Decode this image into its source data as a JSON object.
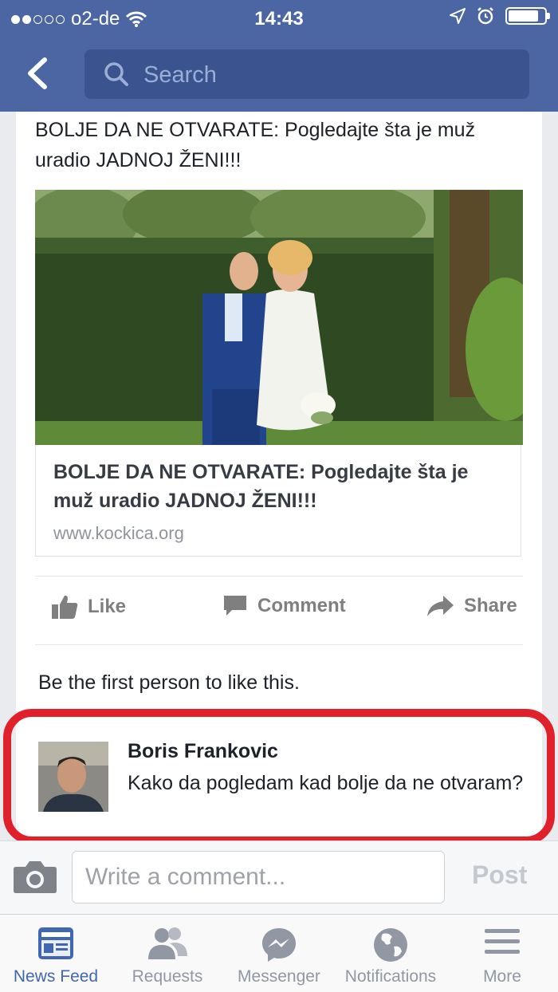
{
  "status_bar": {
    "carrier": "o2-de",
    "time": "14:43",
    "signal_dots_filled": 2,
    "signal_dots_total": 5,
    "battery_level": 0.85
  },
  "nav": {
    "back_icon": "chevron-left-icon",
    "search_placeholder": "Search"
  },
  "post": {
    "text": "BOLJE DA NE OTVARATE: Pogledajte šta je muž uradio JADNOJ ŽENI!!!",
    "link_preview": {
      "title": "BOLJE DA NE OTVARATE: Pogledajte šta je muž uradio JADNOJ ŽENI!!!",
      "domain": "www.kockica.org"
    },
    "actions": {
      "like": "Like",
      "comment": "Comment",
      "share": "Share"
    },
    "likes_summary": "Be the first person to like this."
  },
  "comment": {
    "author": "Boris Frankovic",
    "text": "Kako da pogledam kad bolje da ne otvaram?"
  },
  "compose": {
    "placeholder": "Write a comment...",
    "post_label": "Post"
  },
  "tabs": [
    {
      "label": "News Feed",
      "icon": "news-feed-icon",
      "active": true
    },
    {
      "label": "Requests",
      "icon": "friend-requests-icon",
      "active": false
    },
    {
      "label": "Messenger",
      "icon": "messenger-icon",
      "active": false
    },
    {
      "label": "Notifications",
      "icon": "globe-icon",
      "active": false
    },
    {
      "label": "More",
      "icon": "menu-icon",
      "active": false
    }
  ],
  "colors": {
    "header": "#4c66a4",
    "highlight": "#e0202a",
    "active_tab": "#4267b2"
  }
}
